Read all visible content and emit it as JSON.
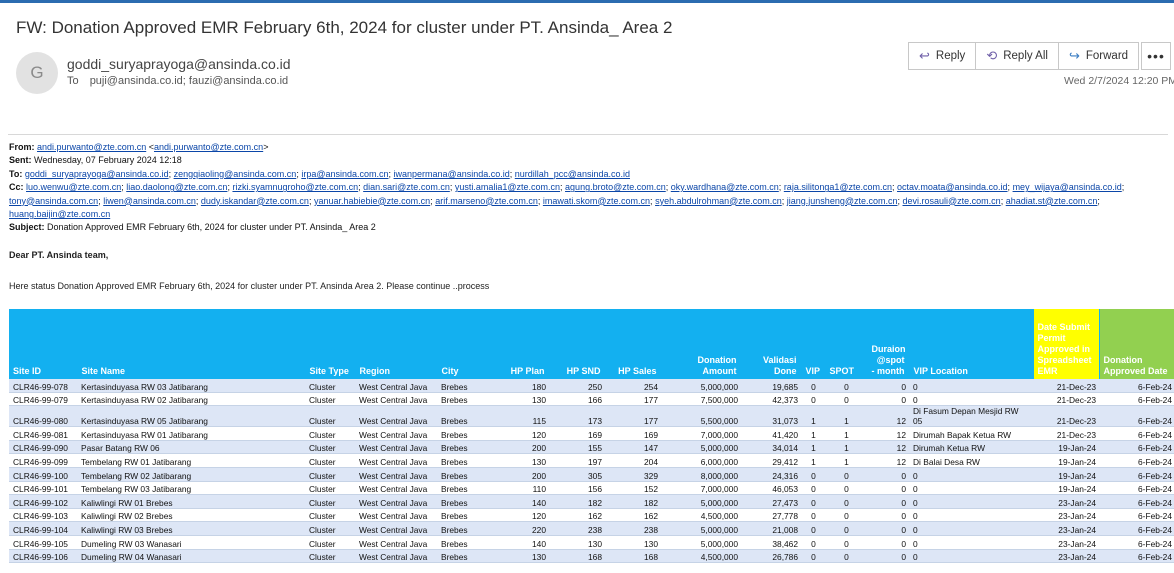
{
  "email": {
    "subject": "FW: Donation Approved EMR February 6th, 2024 for cluster  under PT. Ansinda_ Area 2",
    "avatar_letter": "G",
    "sender": "goddi_suryaprayoga@ansinda.co.id",
    "to_label": "To",
    "to": "puji@ansinda.co.id; fauzi@ansinda.co.id",
    "date": "Wed 2/7/2024 12:20 PM"
  },
  "toolbar": {
    "reply": "Reply",
    "reply_all": "Reply All",
    "forward": "Forward",
    "more": "•••"
  },
  "forwarded": {
    "from_label": "From:",
    "from_link": "andi.purwanto@zte.com.cn",
    "from_lt": " <",
    "from_link2": "andi.purwanto@zte.com.cn",
    "from_gt": ">",
    "sent_label": "Sent:",
    "sent": "Wednesday, 07 February 2024 12:18",
    "to_label": "To:",
    "to_list": [
      "goddi_suryaprayoga@ansinda.co.id",
      "zengqiaoling@ansinda.com.cn",
      "irpa@ansinda.com.cn",
      "iwanpermana@ansinda.co.id",
      "nurdillah_pcc@ansinda.co.id"
    ],
    "cc_label": "Cc:",
    "cc_list": [
      "luo.wenwu@zte.com.cn",
      "liao.daolong@zte.com.cn",
      "rizki.syamnugroho@zte.com.cn",
      "dian.sari@zte.com.cn",
      "yusti.amalia1@zte.com.cn",
      "agung.broto@zte.com.cn",
      "oky.wardhana@zte.com.cn",
      "raja.silitonga1@zte.com.cn",
      "octav.moata@ansinda.co.id",
      "mey_wijaya@ansinda.co.id",
      "tony@ansinda.com.cn",
      "liwen@ansinda.com.cn",
      "dudy.iskandar@zte.com.cn",
      "yanuar.habiebie@zte.com.cn",
      "arif.marseno@zte.com.cn",
      "imawati.skom@zte.com.cn",
      "syeh.abdulrohman@zte.com.cn",
      "jiang.junsheng@zte.com.cn",
      "devi.rosauli@zte.com.cn",
      "ahadiat.st@zte.com.cn",
      "huang.baijin@zte.com.cn"
    ],
    "subject_label": "Subject:",
    "subject": "Donation Approved EMR February 6th, 2024 for cluster under PT. Ansinda_ Area 2"
  },
  "body": {
    "greeting": "Dear PT. Ansinda team,",
    "intro": "Here status Donation Approved EMR February 6th, 2024  for cluster  under PT. Ansinda Area 2.  Please continue ..process"
  },
  "table": {
    "headers": [
      "Site ID",
      "Site Name",
      "Site Type",
      "Region",
      "City",
      "HP Plan",
      "HP SND",
      "HP Sales",
      "Donation Amount",
      "Validasi Done",
      "VIP",
      "SPOT",
      "Duraion @spot - month",
      "VIP Location",
      "Date Submit Permit Approved in Spreadsheet EMR",
      "Donation Approved Date"
    ],
    "rows": [
      [
        "CLR46-99-078",
        "Kertasinduyasa RW 03 Jatibarang",
        "Cluster",
        "West Central Java",
        "Brebes",
        "180",
        "250",
        "254",
        "5,000,000",
        "19,685",
        "0",
        "0",
        "0",
        "0",
        "21-Dec-23",
        "6-Feb-24"
      ],
      [
        "CLR46-99-079",
        "Kertasinduyasa RW 02 Jatibarang",
        "Cluster",
        "West Central Java",
        "Brebes",
        "130",
        "166",
        "177",
        "7,500,000",
        "42,373",
        "0",
        "0",
        "0",
        "0",
        "21-Dec-23",
        "6-Feb-24"
      ],
      [
        "CLR46-99-080",
        "Kertasinduyasa RW 05 Jatibarang",
        "Cluster",
        "West Central Java",
        "Brebes",
        "115",
        "173",
        "177",
        "5,500,000",
        "31,073",
        "1",
        "1",
        "12",
        "Di Fasum Depan Mesjid RW 05",
        "21-Dec-23",
        "6-Feb-24"
      ],
      [
        "CLR46-99-081",
        "Kertasinduyasa RW 01 Jatibarang",
        "Cluster",
        "West Central Java",
        "Brebes",
        "120",
        "169",
        "169",
        "7,000,000",
        "41,420",
        "1",
        "1",
        "12",
        "Dirumah Bapak Ketua RW",
        "21-Dec-23",
        "6-Feb-24"
      ],
      [
        "CLR46-99-090",
        "Pasar Batang RW 06",
        "Cluster",
        "West Central Java",
        "Brebes",
        "200",
        "155",
        "147",
        "5,000,000",
        "34,014",
        "1",
        "1",
        "12",
        "Dirumah Ketua RW",
        "19-Jan-24",
        "6-Feb-24"
      ],
      [
        "CLR46-99-099",
        "Tembelang RW 01 Jatibarang",
        "Cluster",
        "West Central Java",
        "Brebes",
        "130",
        "197",
        "204",
        "6,000,000",
        "29,412",
        "1",
        "1",
        "12",
        "Di Balai Desa RW",
        "19-Jan-24",
        "6-Feb-24"
      ],
      [
        "CLR46-99-100",
        "Tembelang RW 02 Jatibarang",
        "Cluster",
        "West Central Java",
        "Brebes",
        "200",
        "305",
        "329",
        "8,000,000",
        "24,316",
        "0",
        "0",
        "0",
        "0",
        "19-Jan-24",
        "6-Feb-24"
      ],
      [
        "CLR46-99-101",
        "Tembelang RW 03 Jatibarang",
        "Cluster",
        "West Central Java",
        "Brebes",
        "110",
        "156",
        "152",
        "7,000,000",
        "46,053",
        "0",
        "0",
        "0",
        "0",
        "19-Jan-24",
        "6-Feb-24"
      ],
      [
        "CLR46-99-102",
        "Kaliwlingi RW 01 Brebes",
        "Cluster",
        "West Central Java",
        "Brebes",
        "140",
        "182",
        "182",
        "5,000,000",
        "27,473",
        "0",
        "0",
        "0",
        "0",
        "23-Jan-24",
        "6-Feb-24"
      ],
      [
        "CLR46-99-103",
        "Kaliwlingi RW 02 Brebes",
        "Cluster",
        "West Central Java",
        "Brebes",
        "120",
        "162",
        "162",
        "4,500,000",
        "27,778",
        "0",
        "0",
        "0",
        "0",
        "23-Jan-24",
        "6-Feb-24"
      ],
      [
        "CLR46-99-104",
        "Kaliwlingi RW 03 Brebes",
        "Cluster",
        "West Central Java",
        "Brebes",
        "220",
        "238",
        "238",
        "5,000,000",
        "21,008",
        "0",
        "0",
        "0",
        "0",
        "23-Jan-24",
        "6-Feb-24"
      ],
      [
        "CLR46-99-105",
        "Dumeling RW 03 Wanasari",
        "Cluster",
        "West Central Java",
        "Brebes",
        "140",
        "130",
        "130",
        "5,000,000",
        "38,462",
        "0",
        "0",
        "0",
        "0",
        "23-Jan-24",
        "6-Feb-24"
      ],
      [
        "CLR46-99-106",
        "Dumeling RW 04 Wanasari",
        "Cluster",
        "West Central Java",
        "Brebes",
        "130",
        "168",
        "168",
        "4,500,000",
        "26,786",
        "0",
        "0",
        "0",
        "0",
        "23-Jan-24",
        "6-Feb-24"
      ]
    ]
  }
}
